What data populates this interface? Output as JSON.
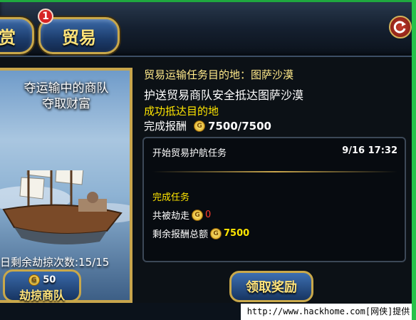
{
  "tabs": {
    "left_partial": "赏",
    "active": "贸易",
    "active_badge": "1"
  },
  "ship_panel": {
    "title_line1": "夺运输中的商队",
    "title_line2": "夺取财富",
    "plunder_count": "日剩余劫掠次数:15/15",
    "plunder_cost": "50",
    "plunder_button": "劫掠商队"
  },
  "mission": {
    "destination": "贸易运输任务目的地：图萨沙漠",
    "description": "护送贸易商队安全抵达图萨沙漠",
    "status": "成功抵达目的地",
    "reward_label": "完成报酬",
    "reward_value": "7500/7500"
  },
  "log": {
    "start_text": "开始贸易护航任务",
    "start_time": "9/16 17:32",
    "done_text": "完成任务",
    "robbed_label": "共被劫走",
    "robbed_value": "0",
    "remaining_label": "剩余报酬总额",
    "remaining_value": "7500"
  },
  "claim_button": "领取奖励",
  "watermark": "http://www.hackhome.com[网侠]提供",
  "colors": {
    "gold": "#c9a84a",
    "yellow_text": "#ffe600",
    "red_text": "#ff3b2e"
  },
  "icons": [
    "gold-coin-icon",
    "back-refresh-icon"
  ]
}
